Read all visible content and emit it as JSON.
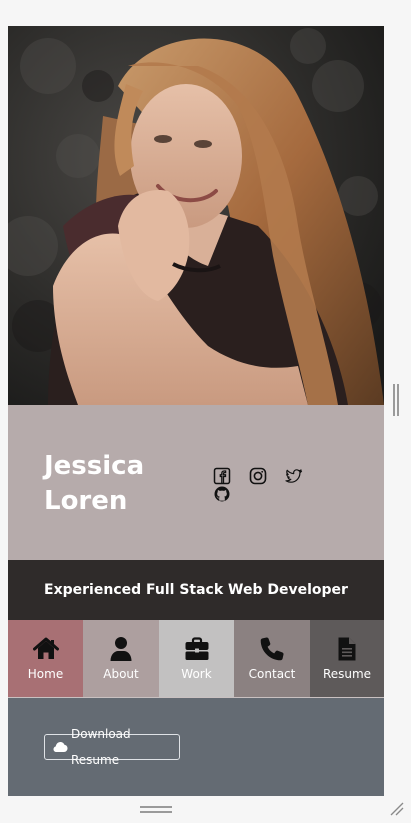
{
  "profile": {
    "first_name": "Jessica",
    "last_name": "Loren",
    "headline": "Experienced Full Stack Web Developer"
  },
  "social": [
    {
      "name": "facebook",
      "icon": "facebook-icon"
    },
    {
      "name": "instagram",
      "icon": "instagram-icon"
    },
    {
      "name": "twitter",
      "icon": "twitter-icon"
    },
    {
      "name": "github",
      "icon": "github-icon"
    }
  ],
  "nav": {
    "items": [
      {
        "label": "Home",
        "icon": "home-icon",
        "color": "#a87074"
      },
      {
        "label": "About",
        "icon": "user-icon",
        "color": "#ad9f9f"
      },
      {
        "label": "Work",
        "icon": "briefcase-icon",
        "color": "#c2c1c1"
      },
      {
        "label": "Contact",
        "icon": "phone-icon",
        "color": "#8b8181"
      },
      {
        "label": "Resume",
        "icon": "document-icon",
        "color": "#5e5a5a"
      }
    ]
  },
  "resume": {
    "download_label": "Download Resume"
  },
  "colors": {
    "name_panel": "#b6abab",
    "headline_bar": "#2f2b2a",
    "content_bg": "#646b73"
  }
}
